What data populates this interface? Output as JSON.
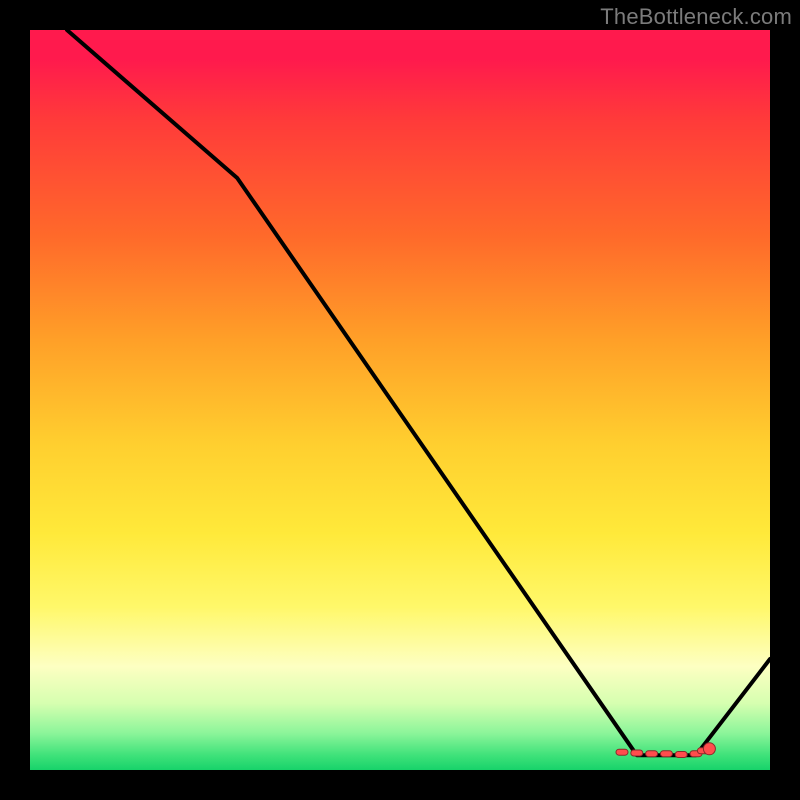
{
  "watermark": "TheBottleneck.com",
  "colors": {
    "frame": "#000000",
    "line": "#000000",
    "marker": "#ff4d4d",
    "marker_stroke": "#8a2a2a",
    "gradient_top": "#ff1a4d",
    "gradient_bottom": "#17d36a"
  },
  "chart_data": {
    "type": "line",
    "title": "",
    "xlabel": "",
    "ylabel": "",
    "xlim": [
      0,
      100
    ],
    "ylim": [
      0,
      100
    ],
    "legend": false,
    "grid": false,
    "annotations": [],
    "series": [
      {
        "name": "curve",
        "x": [
          5,
          28,
          82,
          90,
          100
        ],
        "values": [
          100,
          80,
          2,
          2,
          15
        ]
      }
    ],
    "markers": {
      "name": "scatter-dots",
      "x": [
        80,
        82,
        84,
        86,
        88,
        90,
        91
      ],
      "values": [
        2.4,
        2.3,
        2.2,
        2.2,
        2.1,
        2.2,
        2.6
      ]
    }
  }
}
